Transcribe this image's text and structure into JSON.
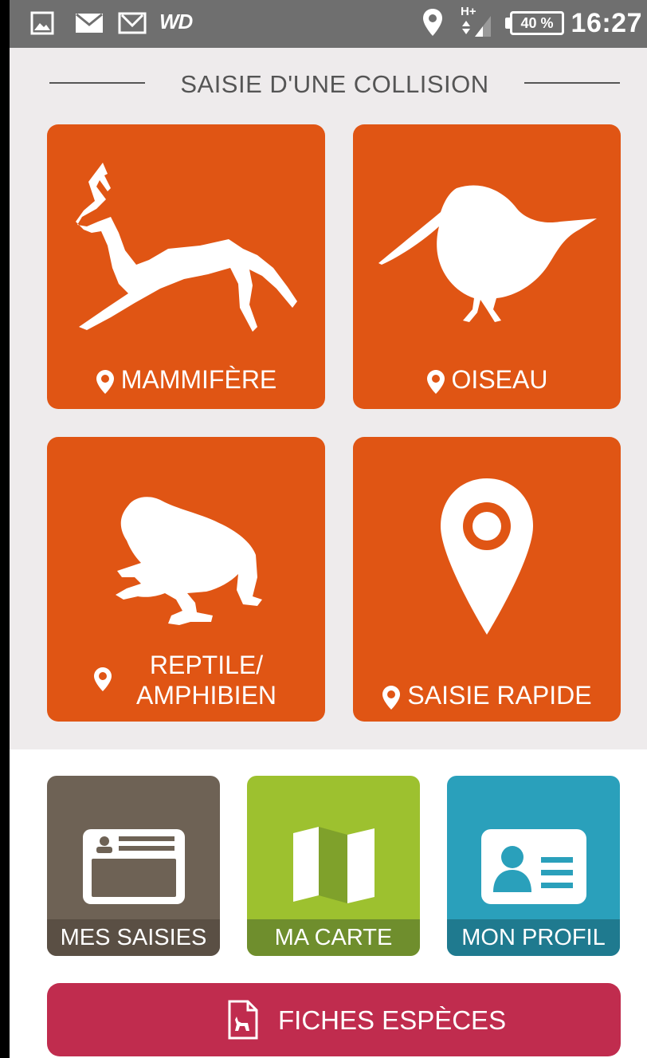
{
  "status_bar": {
    "time": "16:27",
    "battery": "40 %",
    "network": "H+",
    "notification_icons": [
      "gallery-icon",
      "mail-icon",
      "gmail-icon",
      "wd-icon"
    ],
    "wd_label": "WD"
  },
  "section_title": "SAISIE D'UNE COLLISION",
  "tiles": [
    {
      "label": "MAMMIFÈRE",
      "icon": "deer-icon"
    },
    {
      "label": "OISEAU",
      "icon": "bird-icon"
    },
    {
      "label_line1": "REPTILE/",
      "label_line2": "AMPHIBIEN",
      "icon": "frog-icon"
    },
    {
      "label": "SAISIE RAPIDE",
      "icon": "map-pin-icon"
    }
  ],
  "nav": [
    {
      "label": "MES SAISIES",
      "icon": "id-card-icon",
      "color": "#6e6255",
      "label_bg": "#5a4f44"
    },
    {
      "label": "MA CARTE",
      "icon": "map-icon",
      "color": "#9dc12f",
      "label_bg": "#6f8e2d"
    },
    {
      "label": "MON PROFIL",
      "icon": "profile-card-icon",
      "color": "#2aa0bb",
      "label_bg": "#1f7a8f"
    }
  ],
  "fiches_button": {
    "label": "FICHES ESPÈCES",
    "icon": "species-sheet-icon"
  },
  "colors": {
    "accent": "#e05514",
    "section_bg": "#eeebec",
    "fiches": "#c02c4e"
  }
}
